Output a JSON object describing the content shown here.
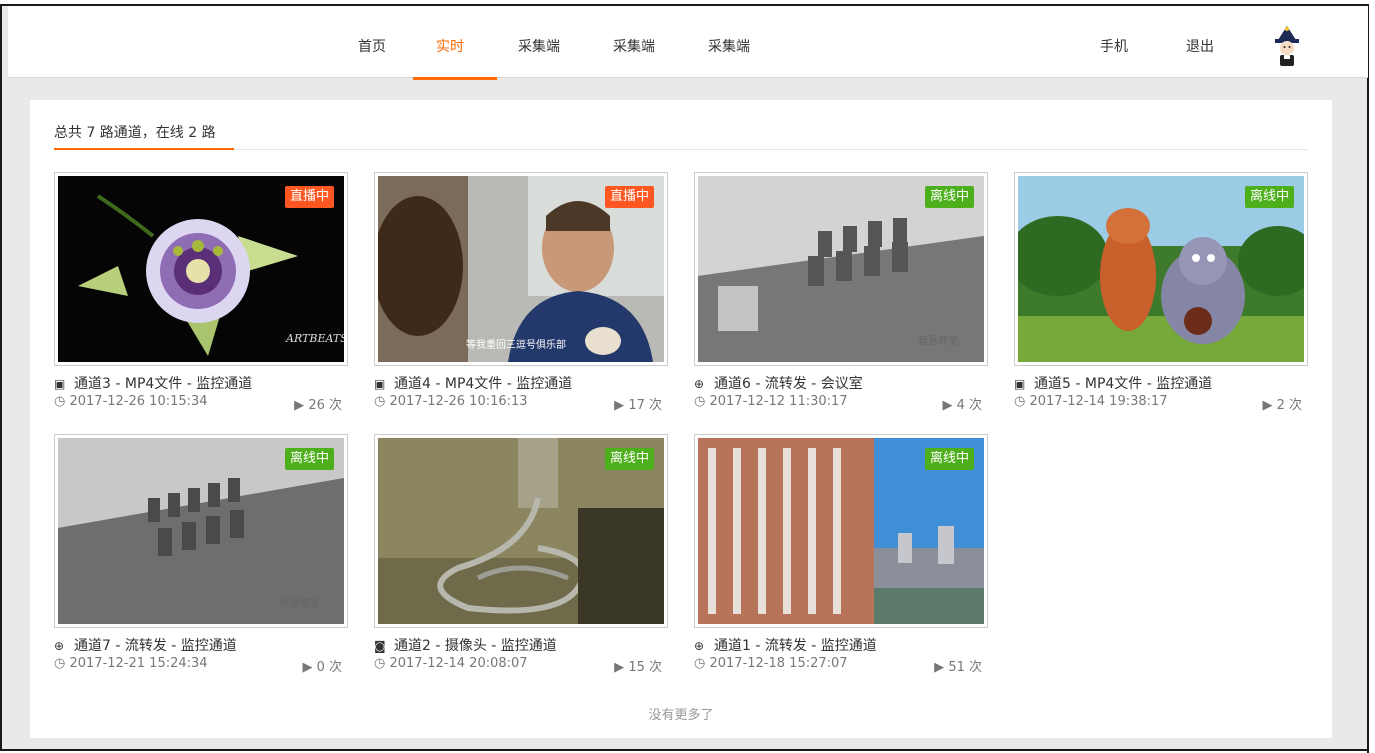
{
  "nav": {
    "items": [
      "首页",
      "实时",
      "采集端",
      "采集端",
      "采集端"
    ],
    "active_index": 1,
    "right": [
      "手机",
      "退出"
    ]
  },
  "summary": "总共 7 路通道，在线 2 路",
  "footer": "没有更多了",
  "cards": [
    {
      "title": "通道3 - MP4文件 - 监控通道",
      "icon": "file-video-icon",
      "glyph": "▣",
      "time": "2017-12-26 10:15:34",
      "plays": "26 次",
      "status": "直播中",
      "live": true
    },
    {
      "title": "通道4 - MP4文件 - 监控通道",
      "icon": "file-video-icon",
      "glyph": "▣",
      "time": "2017-12-26 10:16:13",
      "plays": "17 次",
      "status": "直播中",
      "live": true
    },
    {
      "title": "通道6 - 流转发 - 会议室",
      "icon": "download-circle-icon",
      "glyph": "⊕",
      "time": "2017-12-12 11:30:17",
      "plays": "4 次",
      "status": "离线中",
      "live": false
    },
    {
      "title": "通道5 - MP4文件 - 监控通道",
      "icon": "file-video-icon",
      "glyph": "▣",
      "time": "2017-12-14 19:38:17",
      "plays": "2 次",
      "status": "离线中",
      "live": false
    },
    {
      "title": "通道7 - 流转发 - 监控通道",
      "icon": "download-circle-icon",
      "glyph": "⊕",
      "time": "2017-12-21 15:24:34",
      "plays": "0 次",
      "status": "离线中",
      "live": false
    },
    {
      "title": "通道2 - 摄像头 - 监控通道",
      "icon": "camera-icon",
      "glyph": "◙",
      "time": "2017-12-14 20:08:07",
      "plays": "15 次",
      "status": "离线中",
      "live": false
    },
    {
      "title": "通道1 - 流转发 - 监控通道",
      "icon": "download-circle-icon",
      "glyph": "⊕",
      "time": "2017-12-18 15:27:07",
      "plays": "51 次",
      "status": "离线中",
      "live": false
    }
  ],
  "colors": {
    "accent": "#ff6a00",
    "live": "#ff5722",
    "offline": "#4caf1b"
  }
}
